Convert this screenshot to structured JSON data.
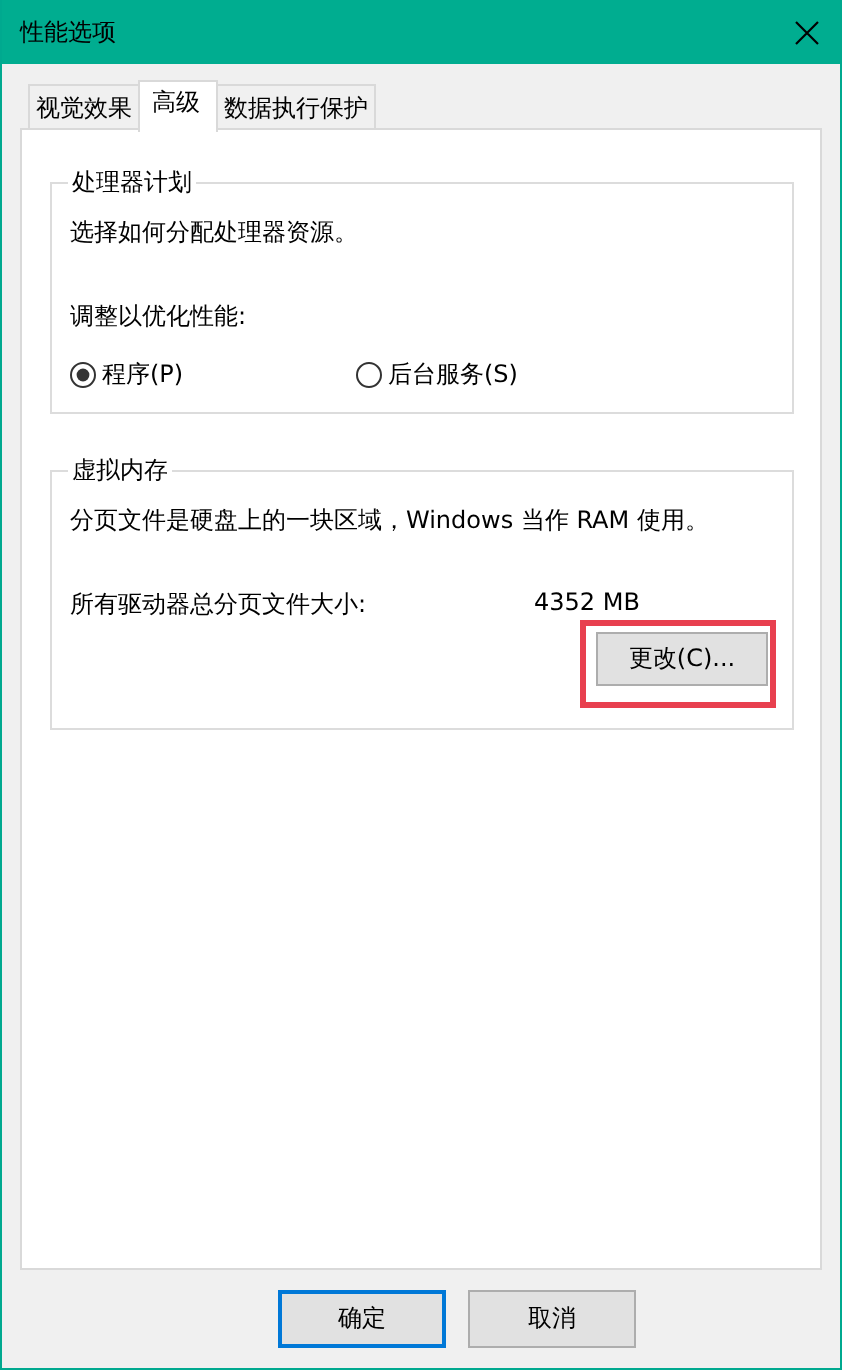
{
  "window": {
    "title": "性能选项"
  },
  "tabs": [
    {
      "label": "视觉效果",
      "selected": false
    },
    {
      "label": "高级",
      "selected": true
    },
    {
      "label": "数据执行保护",
      "selected": false
    }
  ],
  "processor_scheduling": {
    "title": "处理器计划",
    "description": "选择如何分配处理器资源。",
    "adjust_label": "调整以优化性能:",
    "options": [
      {
        "label": "程序(P)",
        "selected": true
      },
      {
        "label": "后台服务(S)",
        "selected": false
      }
    ]
  },
  "virtual_memory": {
    "title": "虚拟内存",
    "description": "分页文件是硬盘上的一块区域，Windows 当作 RAM 使用。",
    "total_label": "所有驱动器总分页文件大小:",
    "total_value": "4352 MB",
    "change_button": {
      "label": "更改(C)...",
      "highlighted": true
    }
  },
  "buttons": [
    {
      "label": "确定",
      "default": true
    },
    {
      "label": "取消",
      "default": false
    }
  ]
}
